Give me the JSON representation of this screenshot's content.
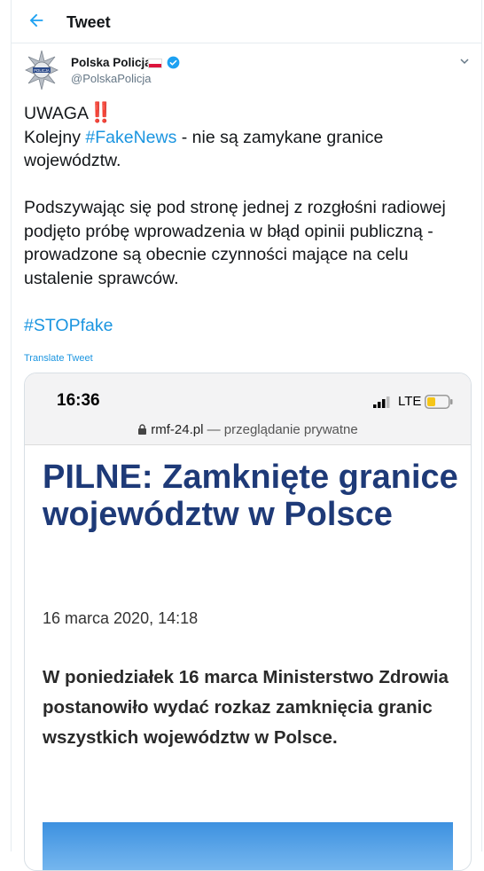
{
  "header": {
    "title": "Tweet",
    "back_icon": "back-arrow-icon"
  },
  "tweet": {
    "author_name": "Polska Policja",
    "author_handle": "@PolskaPolicja",
    "avatar_icon": "police-badge-star-icon",
    "flag_icon": "poland-flag-icon",
    "verified_icon": "verified-badge-icon",
    "menu_icon": "chevron-down-icon",
    "line1_text": "UWAGA",
    "line1_emoji": "‼️",
    "line2_prefix": "Kolejny ",
    "line2_hashtag": "#FakeNews",
    "line2_suffix": " - nie są zamykane granice województw.",
    "paragraph2": "Podszywając się pod stronę jednej z rozgłośni radiowej podjęto próbę wprowadzenia w błąd opinii publiczną - prowadzone są obecnie czynności mające na celu ustalenie sprawców.",
    "hashtag_stop": "#STOPfake",
    "translate_label": "Translate Tweet"
  },
  "media": {
    "status_time": "16:36",
    "network_label": "LTE",
    "url_domain": "rmf-24.pl",
    "url_suffix": " — przeglądanie prywatne",
    "article_title": "PILNE: Zamknięte granice województw w Polsce",
    "article_date": "16 marca 2020, 14:18",
    "article_lead": "W poniedziałek 16 marca Ministerstwo Zdrowia postanowiło wydać rozkaz zamknięcia granic wszystkich województw w Polsce."
  },
  "colors": {
    "link_blue": "#1b95e0",
    "headline_navy": "#1e3a78",
    "verified_blue": "#1da1f2"
  }
}
